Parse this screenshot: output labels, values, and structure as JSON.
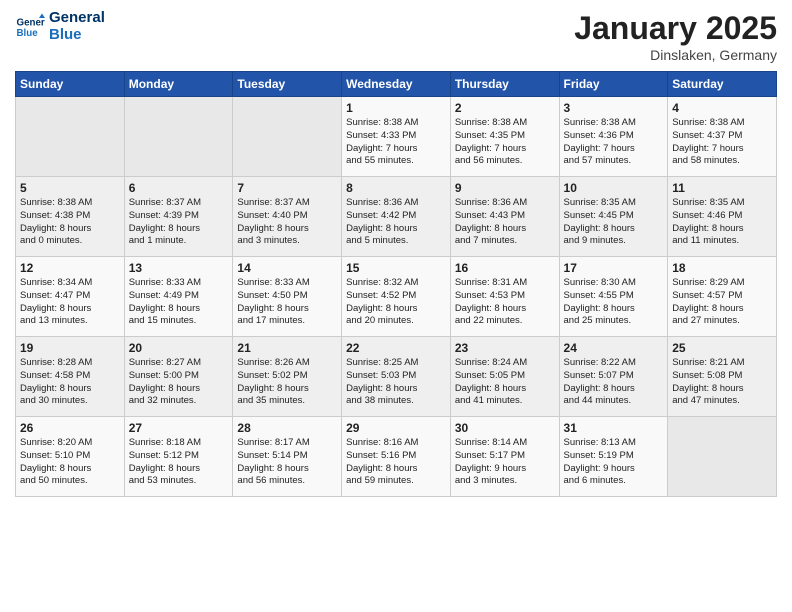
{
  "header": {
    "logo_line1": "General",
    "logo_line2": "Blue",
    "title": "January 2025",
    "subtitle": "Dinslaken, Germany"
  },
  "days_of_week": [
    "Sunday",
    "Monday",
    "Tuesday",
    "Wednesday",
    "Thursday",
    "Friday",
    "Saturday"
  ],
  "weeks": [
    [
      {
        "day": "",
        "info": ""
      },
      {
        "day": "",
        "info": ""
      },
      {
        "day": "",
        "info": ""
      },
      {
        "day": "1",
        "info": "Sunrise: 8:38 AM\nSunset: 4:33 PM\nDaylight: 7 hours\nand 55 minutes."
      },
      {
        "day": "2",
        "info": "Sunrise: 8:38 AM\nSunset: 4:35 PM\nDaylight: 7 hours\nand 56 minutes."
      },
      {
        "day": "3",
        "info": "Sunrise: 8:38 AM\nSunset: 4:36 PM\nDaylight: 7 hours\nand 57 minutes."
      },
      {
        "day": "4",
        "info": "Sunrise: 8:38 AM\nSunset: 4:37 PM\nDaylight: 7 hours\nand 58 minutes."
      }
    ],
    [
      {
        "day": "5",
        "info": "Sunrise: 8:38 AM\nSunset: 4:38 PM\nDaylight: 8 hours\nand 0 minutes."
      },
      {
        "day": "6",
        "info": "Sunrise: 8:37 AM\nSunset: 4:39 PM\nDaylight: 8 hours\nand 1 minute."
      },
      {
        "day": "7",
        "info": "Sunrise: 8:37 AM\nSunset: 4:40 PM\nDaylight: 8 hours\nand 3 minutes."
      },
      {
        "day": "8",
        "info": "Sunrise: 8:36 AM\nSunset: 4:42 PM\nDaylight: 8 hours\nand 5 minutes."
      },
      {
        "day": "9",
        "info": "Sunrise: 8:36 AM\nSunset: 4:43 PM\nDaylight: 8 hours\nand 7 minutes."
      },
      {
        "day": "10",
        "info": "Sunrise: 8:35 AM\nSunset: 4:45 PM\nDaylight: 8 hours\nand 9 minutes."
      },
      {
        "day": "11",
        "info": "Sunrise: 8:35 AM\nSunset: 4:46 PM\nDaylight: 8 hours\nand 11 minutes."
      }
    ],
    [
      {
        "day": "12",
        "info": "Sunrise: 8:34 AM\nSunset: 4:47 PM\nDaylight: 8 hours\nand 13 minutes."
      },
      {
        "day": "13",
        "info": "Sunrise: 8:33 AM\nSunset: 4:49 PM\nDaylight: 8 hours\nand 15 minutes."
      },
      {
        "day": "14",
        "info": "Sunrise: 8:33 AM\nSunset: 4:50 PM\nDaylight: 8 hours\nand 17 minutes."
      },
      {
        "day": "15",
        "info": "Sunrise: 8:32 AM\nSunset: 4:52 PM\nDaylight: 8 hours\nand 20 minutes."
      },
      {
        "day": "16",
        "info": "Sunrise: 8:31 AM\nSunset: 4:53 PM\nDaylight: 8 hours\nand 22 minutes."
      },
      {
        "day": "17",
        "info": "Sunrise: 8:30 AM\nSunset: 4:55 PM\nDaylight: 8 hours\nand 25 minutes."
      },
      {
        "day": "18",
        "info": "Sunrise: 8:29 AM\nSunset: 4:57 PM\nDaylight: 8 hours\nand 27 minutes."
      }
    ],
    [
      {
        "day": "19",
        "info": "Sunrise: 8:28 AM\nSunset: 4:58 PM\nDaylight: 8 hours\nand 30 minutes."
      },
      {
        "day": "20",
        "info": "Sunrise: 8:27 AM\nSunset: 5:00 PM\nDaylight: 8 hours\nand 32 minutes."
      },
      {
        "day": "21",
        "info": "Sunrise: 8:26 AM\nSunset: 5:02 PM\nDaylight: 8 hours\nand 35 minutes."
      },
      {
        "day": "22",
        "info": "Sunrise: 8:25 AM\nSunset: 5:03 PM\nDaylight: 8 hours\nand 38 minutes."
      },
      {
        "day": "23",
        "info": "Sunrise: 8:24 AM\nSunset: 5:05 PM\nDaylight: 8 hours\nand 41 minutes."
      },
      {
        "day": "24",
        "info": "Sunrise: 8:22 AM\nSunset: 5:07 PM\nDaylight: 8 hours\nand 44 minutes."
      },
      {
        "day": "25",
        "info": "Sunrise: 8:21 AM\nSunset: 5:08 PM\nDaylight: 8 hours\nand 47 minutes."
      }
    ],
    [
      {
        "day": "26",
        "info": "Sunrise: 8:20 AM\nSunset: 5:10 PM\nDaylight: 8 hours\nand 50 minutes."
      },
      {
        "day": "27",
        "info": "Sunrise: 8:18 AM\nSunset: 5:12 PM\nDaylight: 8 hours\nand 53 minutes."
      },
      {
        "day": "28",
        "info": "Sunrise: 8:17 AM\nSunset: 5:14 PM\nDaylight: 8 hours\nand 56 minutes."
      },
      {
        "day": "29",
        "info": "Sunrise: 8:16 AM\nSunset: 5:16 PM\nDaylight: 8 hours\nand 59 minutes."
      },
      {
        "day": "30",
        "info": "Sunrise: 8:14 AM\nSunset: 5:17 PM\nDaylight: 9 hours\nand 3 minutes."
      },
      {
        "day": "31",
        "info": "Sunrise: 8:13 AM\nSunset: 5:19 PM\nDaylight: 9 hours\nand 6 minutes."
      },
      {
        "day": "",
        "info": ""
      }
    ]
  ]
}
